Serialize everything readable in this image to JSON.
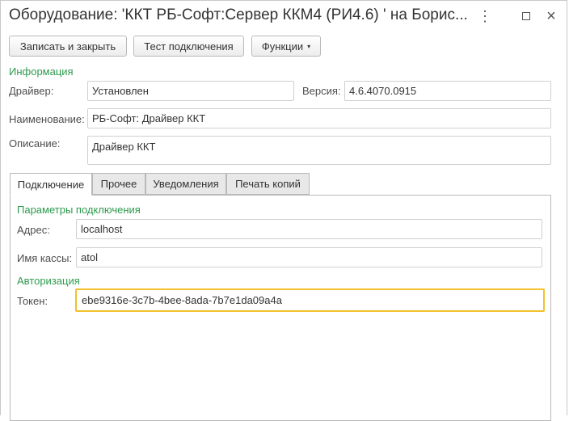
{
  "window": {
    "title": "Оборудование: 'ККТ РБ-Софт:Сервер ККМ4 (РИ4.6) ' на Борис...",
    "more_icon": "more-dots-icon",
    "maximize_icon": "maximize-icon",
    "close_icon": "close-icon",
    "close_glyph": "×"
  },
  "toolbar": {
    "save_close_label": "Записать и закрыть",
    "test_connection_label": "Тест подключения",
    "functions_label": "Функции",
    "functions_caret": "▾"
  },
  "info": {
    "section_title": "Информация",
    "driver_label": "Драйвер:",
    "driver_value": "Установлен",
    "version_label": "Версия:",
    "version_value": "4.6.4070.0915",
    "name_label": "Наименование:",
    "name_value": "РБ-Софт: Драйвер ККТ",
    "description_label": "Описание:",
    "description_value": "Драйвер ККТ"
  },
  "tabs": [
    {
      "label": "Подключение",
      "active": true
    },
    {
      "label": "Прочее",
      "active": false
    },
    {
      "label": "Уведомления",
      "active": false
    },
    {
      "label": "Печать копий",
      "active": false
    }
  ],
  "connection": {
    "params_title": "Параметры подключения",
    "address_label": "Адрес:",
    "address_value": "localhost",
    "cashbox_label": "Имя кассы:",
    "cashbox_value": "atol",
    "auth_title": "Авторизация",
    "token_label": "Токен:",
    "token_value": "ebe9316e-3c7b-4bee-8ada-7b7e1da09a4a"
  },
  "colors": {
    "section_title": "#2e9a4e",
    "active_field_border": "#f3c12b"
  }
}
